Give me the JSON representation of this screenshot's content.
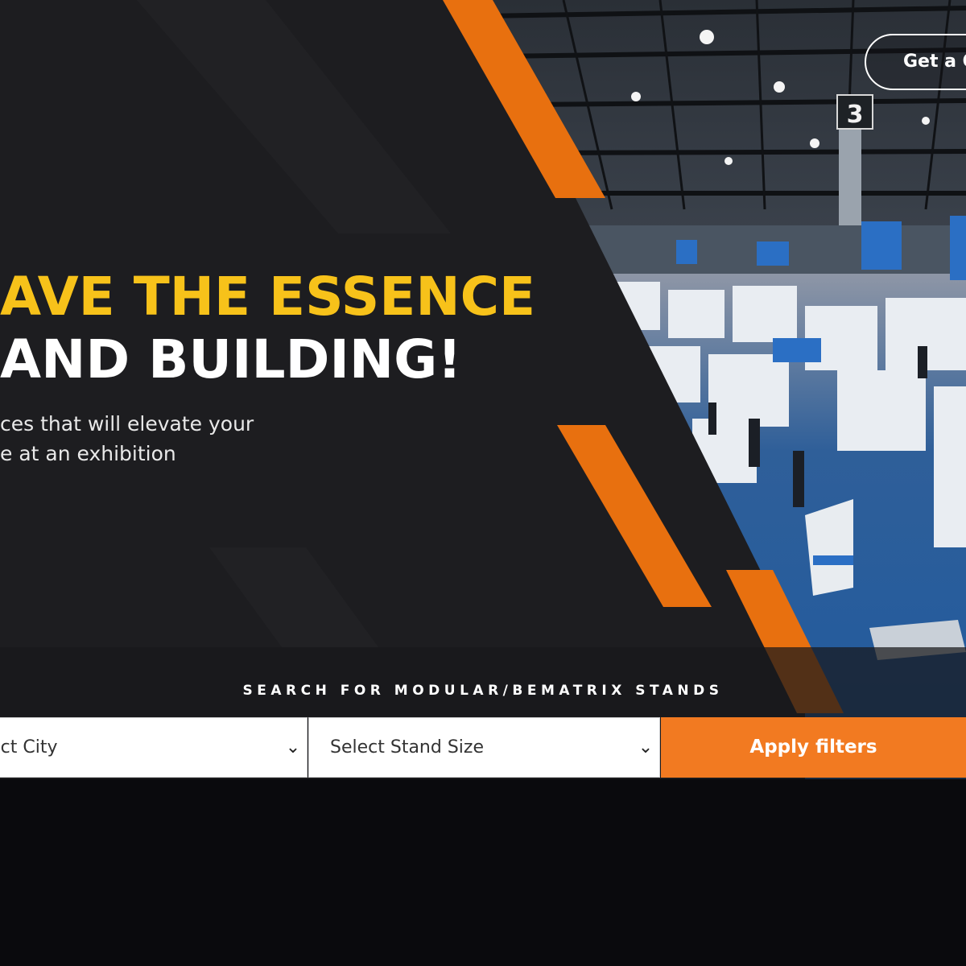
{
  "hero": {
    "headline_line1": "AVE THE ESSENCE",
    "headline_line2": "AND BUILDING!",
    "subtext_line1": "ces that will elevate your",
    "subtext_line2": "e at an exhibition"
  },
  "header": {
    "cta_label": "Get a Q"
  },
  "search": {
    "label": "SEARCH FOR MODULAR/BEMATRIX STANDS",
    "city_value": "lect City",
    "stand_size_value": "Select Stand Size",
    "apply_label": "Apply filters"
  },
  "photo": {
    "hall_sign": "3"
  },
  "colors": {
    "accent_orange": "#f27a21",
    "stripe_orange": "#e8700f",
    "headline_yellow": "#f7c21a",
    "panel_dark": "#1d1d20",
    "page_bg": "#0a0a0d"
  }
}
